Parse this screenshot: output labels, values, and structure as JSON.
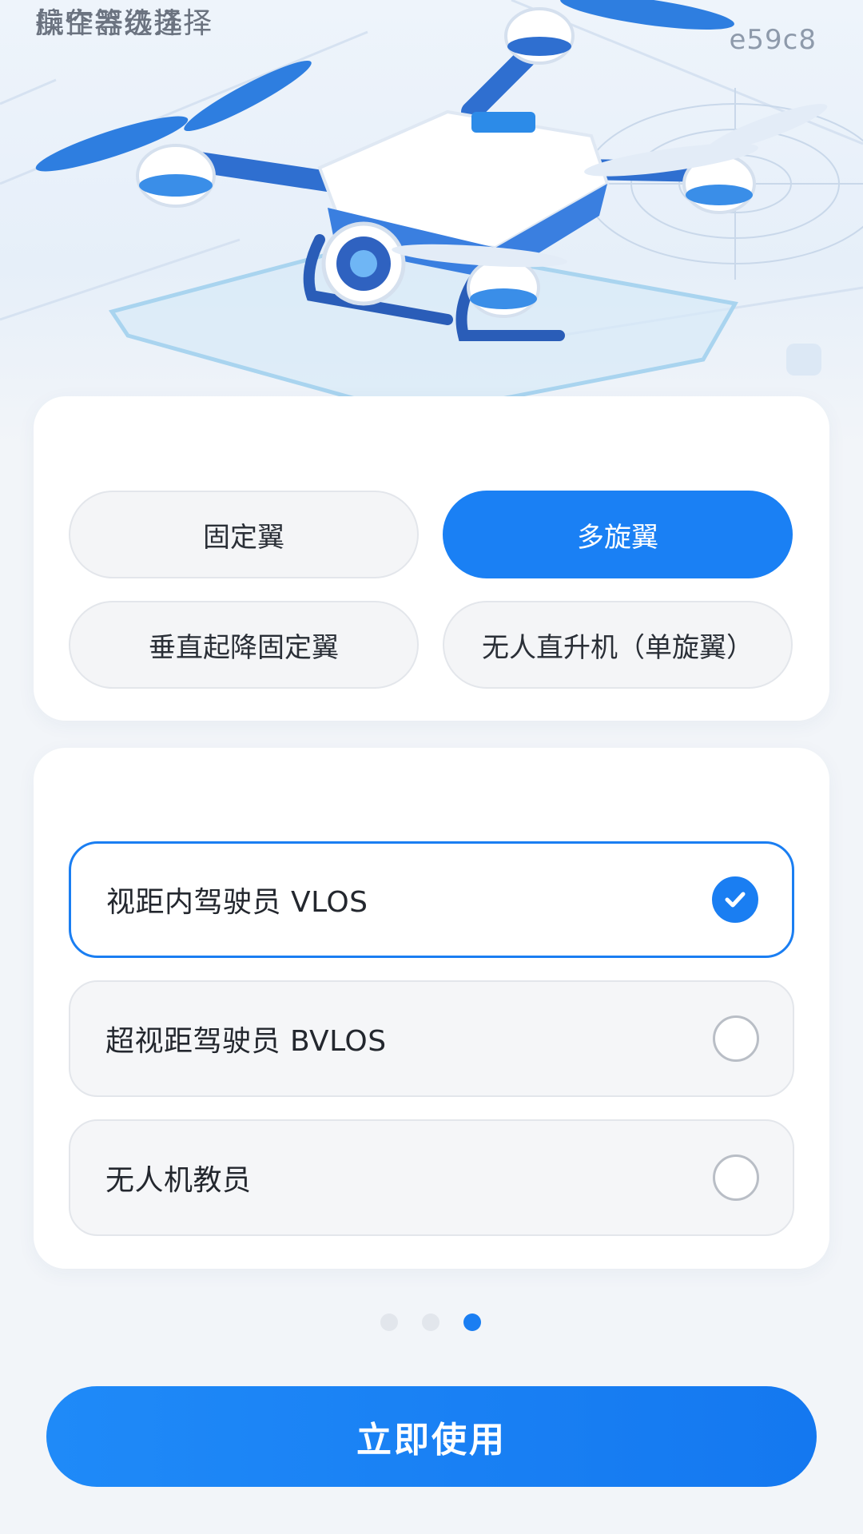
{
  "watermark": "e59c8",
  "aircraft_section": {
    "title": "航空器选择",
    "options": [
      {
        "label": "固定翼",
        "selected": false
      },
      {
        "label": "多旋翼",
        "selected": true
      },
      {
        "label": "垂直起降固定翼",
        "selected": false
      },
      {
        "label": "无人直升机（单旋翼）",
        "selected": false
      }
    ]
  },
  "level_section": {
    "title": "操作等级选择",
    "options": [
      {
        "label": "视距内驾驶员 VLOS",
        "selected": true
      },
      {
        "label": "超视距驾驶员 BVLOS",
        "selected": false
      },
      {
        "label": "无人机教员",
        "selected": false
      }
    ]
  },
  "pager": {
    "total": 3,
    "current": 3
  },
  "cta_label": "立即使用",
  "colors": {
    "accent": "#1a80f4",
    "background": "#f2f5f9",
    "card": "#ffffff",
    "title_text": "#6b7380"
  },
  "icons": {
    "selected_indicator": "checkmark-icon",
    "illustration": "drone-illustration"
  }
}
